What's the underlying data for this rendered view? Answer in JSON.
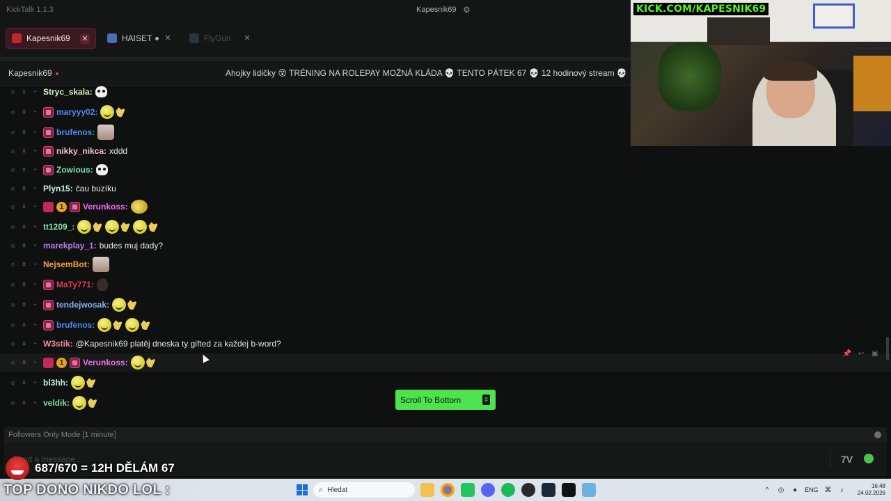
{
  "app": {
    "title": "KickTalk 1.1.3"
  },
  "user_menu": {
    "username": "Kapesnik69",
    "settings_icon": "gear-icon"
  },
  "tabs": [
    {
      "label": "Kapesnik69",
      "active": true
    },
    {
      "label": "HAISET",
      "active": false,
      "live": true
    },
    {
      "label": "FlyGun",
      "active": false
    }
  ],
  "channel": {
    "name": "Kapesnik69",
    "stream_title": "Ahojky lidičky 😵 TRÉNING NA ROLEPAY MOŽNÁ KLÁDA 💀 TENTO PÁTEK 67 💀 12 hodinový stream 💀"
  },
  "messages": [
    {
      "user": "Stryc_skala",
      "color": "#d8f5c8",
      "badges": [],
      "text": "",
      "emotes": [
        "skull"
      ]
    },
    {
      "user": "maryyy02",
      "color": "#4a8cf0",
      "badges": [
        "sub"
      ],
      "text": "",
      "emotes": [
        "smile",
        "hand"
      ]
    },
    {
      "user": "brufenos",
      "color": "#4a8cf0",
      "badges": [
        "sub"
      ],
      "text": "",
      "emotes": [
        "cat"
      ]
    },
    {
      "user": "nikky_nikca",
      "color": "#f7c2d8",
      "badges": [
        "sub"
      ],
      "text": "xddd",
      "emotes": []
    },
    {
      "user": "Zowious",
      "color": "#7fe0b0",
      "badges": [
        "sub"
      ],
      "text": "",
      "emotes": [
        "skull"
      ]
    },
    {
      "user": "Plyn15",
      "color": "#c8f0d8",
      "badges": [],
      "text": "čau buzíku",
      "emotes": []
    },
    {
      "user": "Verunkoss",
      "color": "#f36cf3",
      "badges": [
        "gift",
        "num",
        "sub"
      ],
      "text": "",
      "emotes": [
        "cool"
      ]
    },
    {
      "user": "tt1209_",
      "color": "#7fe0b0",
      "badges": [],
      "text": "",
      "emotes": [
        "smile",
        "hand",
        "smile",
        "hand",
        "smile",
        "hand"
      ]
    },
    {
      "user": "marekplay_1",
      "color": "#b57cf0",
      "badges": [],
      "text": "budes muj dady?",
      "emotes": []
    },
    {
      "user": "NejsemBot",
      "color": "#f0a040",
      "badges": [],
      "text": "",
      "emotes": [
        "cat"
      ]
    },
    {
      "user": "MaTy771",
      "color": "#e03a5a",
      "badges": [
        "sub"
      ],
      "text": "",
      "emotes": [
        "dark"
      ]
    },
    {
      "user": "tendejwosak",
      "color": "#88b0f0",
      "badges": [
        "sub"
      ],
      "text": "",
      "emotes": [
        "smile",
        "hand"
      ]
    },
    {
      "user": "brufenos",
      "color": "#4a8cf0",
      "badges": [
        "sub"
      ],
      "text": "",
      "emotes": [
        "smile",
        "hand",
        "smile",
        "hand"
      ]
    },
    {
      "user": "W3stik",
      "color": "#f08a9a",
      "badges": [],
      "text": "@Kapesnik69 platěj dneska ty gifted za každej b-word?",
      "emotes": []
    },
    {
      "user": "Verunkoss",
      "color": "#f36cf3",
      "badges": [
        "gift",
        "num",
        "sub"
      ],
      "text": "",
      "emotes": [
        "smile",
        "hand"
      ]
    },
    {
      "user": "bl3hh",
      "color": "#c8f0d8",
      "badges": [],
      "text": "",
      "emotes": [
        "smile",
        "hand"
      ]
    },
    {
      "user": "veldik",
      "color": "#7fe0b0",
      "badges": [],
      "text": "",
      "emotes": [
        "smile",
        "hand"
      ]
    }
  ],
  "badge_number": "1",
  "scroll_to_bottom": {
    "label": "Scroll To Bottom"
  },
  "chat_mode": {
    "label": "Followers Only Mode [1 minute]"
  },
  "input": {
    "placeholder": "Send a message..."
  },
  "overlays": {
    "webcam_banner": "KICK.COM/KAPESNIK69",
    "goal_text": "687/670 = 12H DĚLÁM 67",
    "top_dono": "TOP DONO NIKDO LOL :"
  },
  "taskbar": {
    "search_placeholder": "Hledat",
    "language": "ENG",
    "time": "16:48",
    "date": "24.02.2026"
  }
}
